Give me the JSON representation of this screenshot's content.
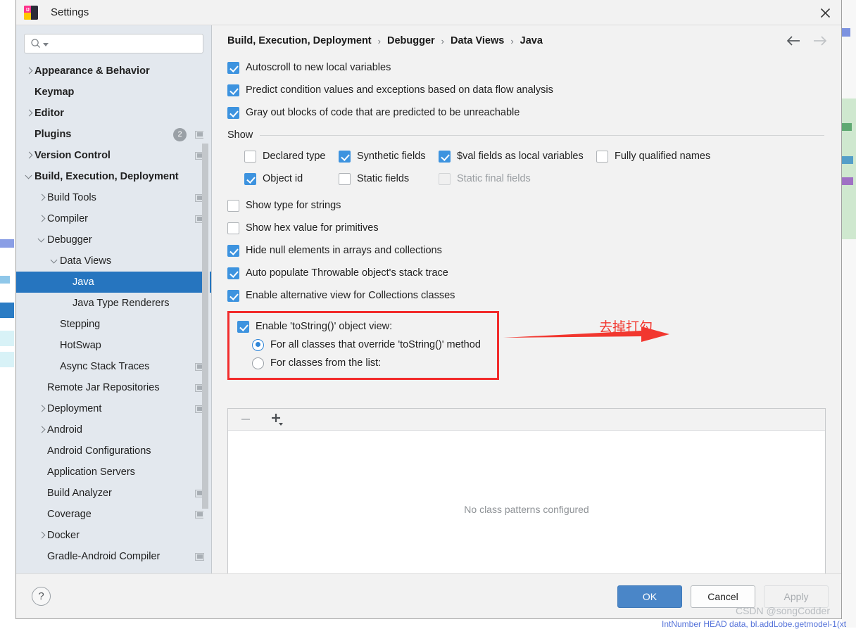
{
  "window": {
    "title": "Settings",
    "logo_icon": "intellij-idea-logo",
    "close_icon": "close-icon"
  },
  "sidebar": {
    "search": {
      "placeholder": "",
      "value": "",
      "icon": "search-icon",
      "dropdown_icon": "chevron-down-icon"
    },
    "items": [
      {
        "label": "Appearance & Behavior",
        "arrow": "right",
        "indent": 0,
        "bold": true,
        "badge": null,
        "chip": false,
        "selected": false
      },
      {
        "label": "Keymap",
        "arrow": "none",
        "indent": 0,
        "bold": true,
        "badge": null,
        "chip": false,
        "selected": false
      },
      {
        "label": "Editor",
        "arrow": "right",
        "indent": 0,
        "bold": true,
        "badge": null,
        "chip": false,
        "selected": false
      },
      {
        "label": "Plugins",
        "arrow": "none",
        "indent": 0,
        "bold": true,
        "badge": "2",
        "chip": true,
        "selected": false
      },
      {
        "label": "Version Control",
        "arrow": "right",
        "indent": 0,
        "bold": true,
        "badge": null,
        "chip": true,
        "selected": false
      },
      {
        "label": "Build, Execution, Deployment",
        "arrow": "down",
        "indent": 0,
        "bold": true,
        "badge": null,
        "chip": false,
        "selected": false
      },
      {
        "label": "Build Tools",
        "arrow": "right",
        "indent": 1,
        "bold": false,
        "badge": null,
        "chip": true,
        "selected": false
      },
      {
        "label": "Compiler",
        "arrow": "right",
        "indent": 1,
        "bold": false,
        "badge": null,
        "chip": true,
        "selected": false
      },
      {
        "label": "Debugger",
        "arrow": "down",
        "indent": 1,
        "bold": false,
        "badge": null,
        "chip": false,
        "selected": false
      },
      {
        "label": "Data Views",
        "arrow": "down",
        "indent": 2,
        "bold": false,
        "badge": null,
        "chip": false,
        "selected": false
      },
      {
        "label": "Java",
        "arrow": "none",
        "indent": 3,
        "bold": false,
        "badge": null,
        "chip": false,
        "selected": true
      },
      {
        "label": "Java Type Renderers",
        "arrow": "none",
        "indent": 3,
        "bold": false,
        "badge": null,
        "chip": false,
        "selected": false
      },
      {
        "label": "Stepping",
        "arrow": "none",
        "indent": 2,
        "bold": false,
        "badge": null,
        "chip": false,
        "selected": false
      },
      {
        "label": "HotSwap",
        "arrow": "none",
        "indent": 2,
        "bold": false,
        "badge": null,
        "chip": false,
        "selected": false
      },
      {
        "label": "Async Stack Traces",
        "arrow": "none",
        "indent": 2,
        "bold": false,
        "badge": null,
        "chip": true,
        "selected": false
      },
      {
        "label": "Remote Jar Repositories",
        "arrow": "none",
        "indent": 1,
        "bold": false,
        "badge": null,
        "chip": true,
        "selected": false
      },
      {
        "label": "Deployment",
        "arrow": "right",
        "indent": 1,
        "bold": false,
        "badge": null,
        "chip": true,
        "selected": false
      },
      {
        "label": "Android",
        "arrow": "right",
        "indent": 1,
        "bold": false,
        "badge": null,
        "chip": false,
        "selected": false
      },
      {
        "label": "Android Configurations",
        "arrow": "none",
        "indent": 1,
        "bold": false,
        "badge": null,
        "chip": false,
        "selected": false
      },
      {
        "label": "Application Servers",
        "arrow": "none",
        "indent": 1,
        "bold": false,
        "badge": null,
        "chip": false,
        "selected": false
      },
      {
        "label": "Build Analyzer",
        "arrow": "none",
        "indent": 1,
        "bold": false,
        "badge": null,
        "chip": true,
        "selected": false
      },
      {
        "label": "Coverage",
        "arrow": "none",
        "indent": 1,
        "bold": false,
        "badge": null,
        "chip": true,
        "selected": false
      },
      {
        "label": "Docker",
        "arrow": "right",
        "indent": 1,
        "bold": false,
        "badge": null,
        "chip": false,
        "selected": false
      },
      {
        "label": "Gradle-Android Compiler",
        "arrow": "none",
        "indent": 1,
        "bold": false,
        "badge": null,
        "chip": true,
        "selected": false
      }
    ]
  },
  "breadcrumb": {
    "parts": [
      "Build, Execution, Deployment",
      "Debugger",
      "Data Views",
      "Java"
    ],
    "separator": "›",
    "back_icon": "arrow-left-icon",
    "forward_icon": "arrow-right-icon"
  },
  "main": {
    "top_options": [
      {
        "label": "Autoscroll to new local variables",
        "checked": true,
        "enabled": true
      },
      {
        "label": "Predict condition values and exceptions based on data flow analysis",
        "checked": true,
        "enabled": true
      },
      {
        "label": "Gray out blocks of code that are predicted to be unreachable",
        "checked": true,
        "enabled": true
      }
    ],
    "show_group": {
      "title": "Show",
      "row1": [
        {
          "label": "Declared type",
          "checked": false,
          "enabled": true
        },
        {
          "label": "Synthetic fields",
          "checked": true,
          "enabled": true
        },
        {
          "label": "$val fields as local variables",
          "checked": true,
          "enabled": true
        },
        {
          "label": "Fully qualified names",
          "checked": false,
          "enabled": true
        }
      ],
      "row2": [
        {
          "label": "Object id",
          "checked": true,
          "enabled": true
        },
        {
          "label": "Static fields",
          "checked": false,
          "enabled": true
        },
        {
          "label": "Static final fields",
          "checked": false,
          "enabled": false
        }
      ]
    },
    "mid_options": [
      {
        "label": "Show type for strings",
        "checked": false,
        "enabled": true
      },
      {
        "label": "Show hex value for primitives",
        "checked": false,
        "enabled": true
      },
      {
        "label": "Hide null elements in arrays and collections",
        "checked": true,
        "enabled": true
      },
      {
        "label": "Auto populate Throwable object's stack trace",
        "checked": true,
        "enabled": true
      },
      {
        "label": "Enable alternative view for Collections classes",
        "checked": true,
        "enabled": true
      }
    ],
    "tostring": {
      "enable_label": "Enable 'toString()' object view:",
      "enable_checked": true,
      "radio_all_label": "For all classes that override 'toString()' method",
      "radio_all_selected": true,
      "radio_list_label": "For classes from the list:",
      "radio_list_selected": false
    },
    "patterns": {
      "remove_icon": "minus-icon",
      "add_icon": "plus-icon",
      "empty_text": "No class patterns configured"
    }
  },
  "annotation": {
    "text": "去掉打勾",
    "arrow_icon": "arrow-right-annotation",
    "color": "#f2372f"
  },
  "footer": {
    "help_label": "?",
    "ok_label": "OK",
    "cancel_label": "Cancel",
    "apply_label": "Apply",
    "watermark": "CSDN @songCodder"
  },
  "background": {
    "bottom_code": "IntNumber HEAD data, bl.addLobe.getmodel-1(xt"
  },
  "colors": {
    "accent_blue": "#3d93df",
    "selection_blue": "#2675bf",
    "ok_button": "#4a86c8",
    "annotation_red": "#f22c2c"
  }
}
